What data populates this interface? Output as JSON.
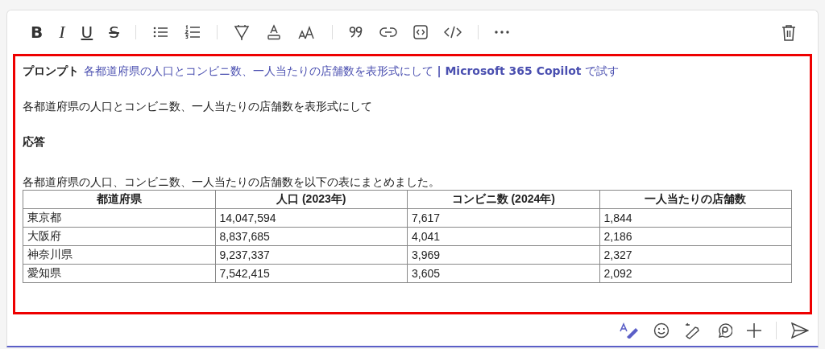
{
  "toolbar": {
    "format_buttons": [
      {
        "label": "B"
      },
      {
        "label": "I"
      },
      {
        "label": "U"
      },
      {
        "label": "S"
      }
    ]
  },
  "message": {
    "prompt_label": "プロンプト",
    "prompt_link": "各都道府県の人口とコンビニ数、一人当たりの店舗数を表形式にして **| Microsoft 365 Copilot** で試す",
    "prompt_text": "各都道府県の人口とコンビニ数、一人当たりの店舗数を表形式にして",
    "response_label": "応答",
    "response_text": "各都道府県の人口、コンビニ数、一人当たりの店舗数を以下の表にまとめました。",
    "table": {
      "columns": [
        "都道府県",
        "人口 (2023年)",
        "コンビニ数 (2024年)",
        "一人当たりの店舗数"
      ],
      "rows": [
        [
          "東京都",
          "14,047,594",
          "7,617",
          "1,844"
        ],
        [
          "大阪府",
          "8,837,685",
          "4,041",
          "2,186"
        ],
        [
          "神奈川県",
          "9,237,337",
          "3,969",
          "2,327"
        ],
        [
          "愛知県",
          "7,542,415",
          "3,605",
          "2,092"
        ]
      ]
    }
  }
}
